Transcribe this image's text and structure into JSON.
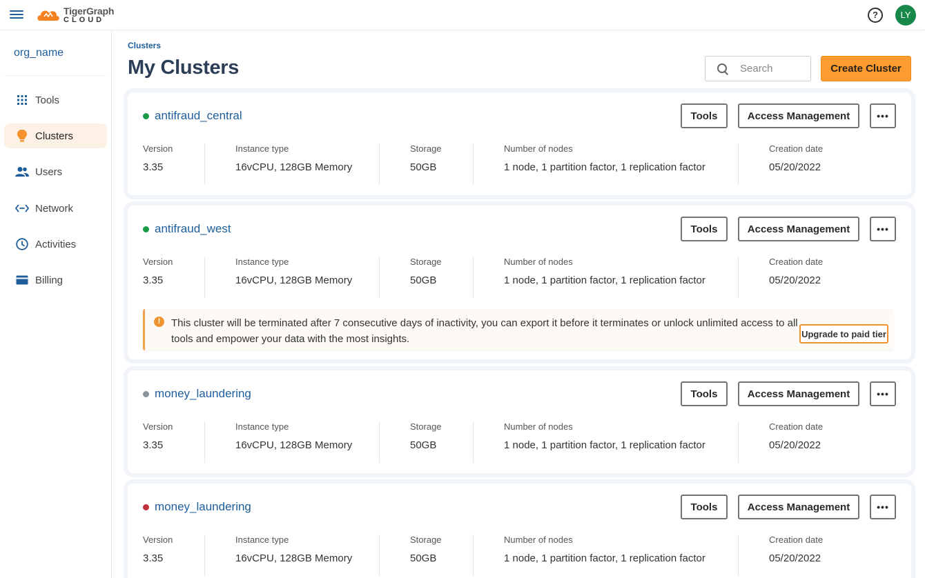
{
  "topbar": {
    "logo_brand": "TigerGraph",
    "logo_sub": "CLOUD",
    "help_glyph": "?",
    "avatar_initials": "LY",
    "avatar_color": "#17884a"
  },
  "sidebar": {
    "org_name": "org_name",
    "items": [
      {
        "label": "Tools",
        "icon": "grid-icon"
      },
      {
        "label": "Clusters",
        "icon": "lightbulb-icon",
        "active": true
      },
      {
        "label": "Users",
        "icon": "users-icon"
      },
      {
        "label": "Network",
        "icon": "network-icon"
      },
      {
        "label": "Activities",
        "icon": "clock-icon"
      },
      {
        "label": "Billing",
        "icon": "credit-card-icon"
      }
    ]
  },
  "main": {
    "breadcrumb": "Clusters",
    "title": "My Clusters",
    "search_placeholder": "Search",
    "create_label": "Create Cluster"
  },
  "labels": {
    "version": "Version",
    "instance": "Instance type",
    "storage": "Storage",
    "nodes": "Number of nodes",
    "created": "Creation date",
    "tools_btn": "Tools",
    "access_btn": "Access Management",
    "more_btn": "•••"
  },
  "clusters": [
    {
      "name": "antifraud_central",
      "status_color": "#1a9a44",
      "version": "3.35",
      "instance": "16vCPU, 128GB Memory",
      "storage": "50GB",
      "nodes": "1 node, 1 partition factor, 1 replication factor",
      "created": "05/20/2022"
    },
    {
      "name": "antifraud_west",
      "status_color": "#1a9a44",
      "version": "3.35",
      "instance": "16vCPU, 128GB Memory",
      "storage": "50GB",
      "nodes": "1 node, 1 partition factor, 1 replication factor",
      "created": "05/20/2022"
    },
    {
      "name": "money_laundering",
      "status_color": "#8a929b",
      "version": "3.35",
      "instance": "16vCPU, 128GB Memory",
      "storage": "50GB",
      "nodes": "1 node, 1 partition factor, 1 replication factor",
      "created": "05/20/2022"
    },
    {
      "name": "money_laundering",
      "status_color": "#c0303a",
      "version": "3.35",
      "instance": "16vCPU, 128GB Memory",
      "storage": "50GB",
      "nodes": "1 node, 1 partition factor, 1 replication factor",
      "created": "05/20/2022"
    }
  ],
  "banner": {
    "text": "This cluster will be terminated after 7 consecutive days of inactivity, you can export it before it terminates or unlock unlimited access to all tools and empower your data with the most insights.",
    "button": "Upgrade to paid tier",
    "icon_glyph": "!"
  }
}
